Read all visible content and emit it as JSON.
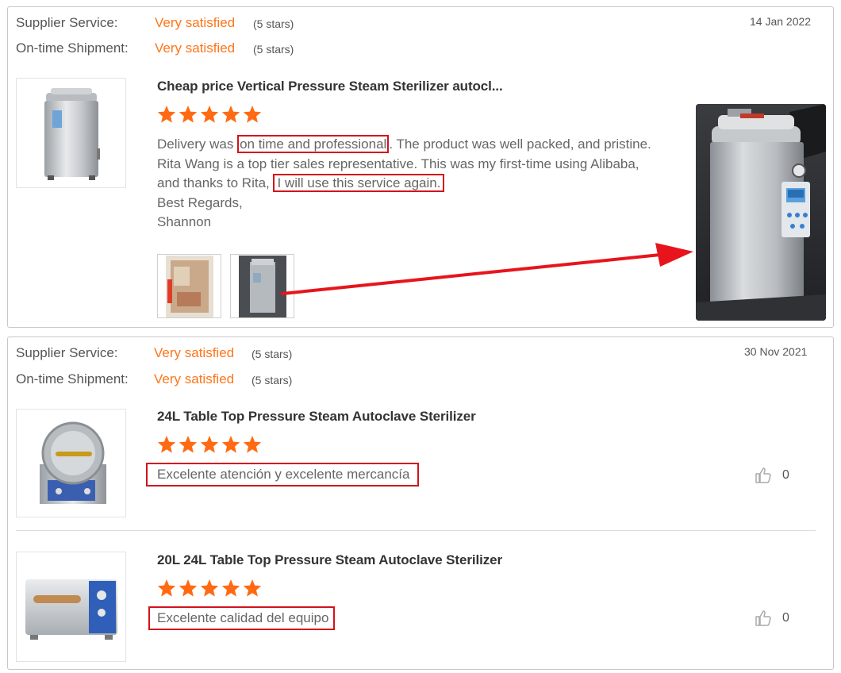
{
  "reviews": [
    {
      "supplier_service_label": "Supplier Service:",
      "supplier_service_rating": "Very satisfied",
      "supplier_service_stars": "(5 stars)",
      "shipment_label": "On-time Shipment:",
      "shipment_rating": "Very satisfied",
      "shipment_stars": "(5 stars)",
      "date": "14 Jan 2022",
      "items": [
        {
          "product_title": "Cheap price Vertical Pressure Steam Sterilizer autocl...",
          "star_rating": 5,
          "review_text": {
            "line1_pre": "Delivery was ",
            "line1_highlight": "on time and professional",
            "line1_post": ". The product was well packed, and pristine.",
            "line2": "Rita Wang is a top tier sales representative. This was my first-time using Alibaba,",
            "line3_pre": "and thanks to Rita, ",
            "line3_highlight": "I will use this service again.",
            "line4": "Best Regards,",
            "line5": "Shannon"
          }
        }
      ]
    },
    {
      "supplier_service_label": "Supplier Service:",
      "supplier_service_rating": "Very satisfied",
      "supplier_service_stars": "(5 stars)",
      "shipment_label": "On-time Shipment:",
      "shipment_rating": "Very satisfied",
      "shipment_stars": "(5 stars)",
      "date": "30 Nov 2021",
      "items": [
        {
          "product_title": "24L Table Top Pressure Steam Autoclave Sterilizer",
          "star_rating": 5,
          "review_text": "Excelente atención y excelente mercancía",
          "likes": "0"
        },
        {
          "product_title": "20L 24L Table Top Pressure Steam Autoclave Sterilizer",
          "star_rating": 5,
          "review_text": "Excelente calidad del equipo",
          "likes": "0"
        }
      ]
    }
  ],
  "colors": {
    "rating": "#ff7519",
    "star": "#ff6a13",
    "highlight": "#d2121c",
    "arrow": "#e8141c"
  },
  "icons": {
    "star": "star-icon",
    "like": "thumbs-up-icon",
    "arrow": "arrow-right-icon"
  }
}
